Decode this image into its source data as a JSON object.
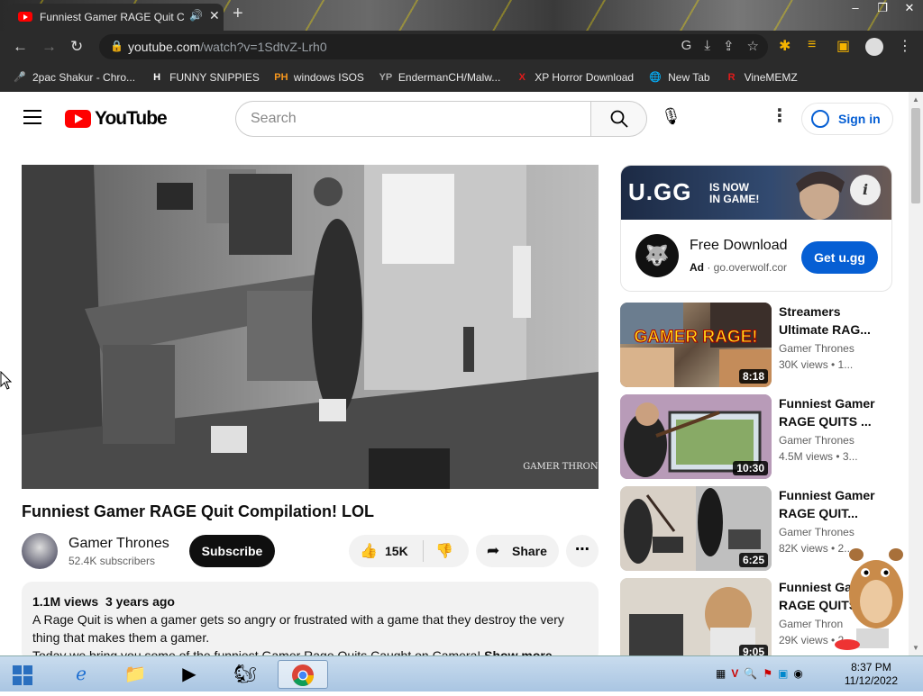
{
  "browser": {
    "tab_title": "Funniest Gamer RAGE Quit C",
    "new_tab": "+",
    "url_host": "youtube.com",
    "url_path": "/watch?v=1SdtvZ-Lrh0",
    "bookmarks": [
      {
        "label": "2pac Shakur - Chro...",
        "icon": "🎤",
        "color": "#e8e8e8"
      },
      {
        "label": "FUNNY SNIPPIES",
        "icon": "H",
        "color": "#ffffff"
      },
      {
        "label": "windows ISOS",
        "icon": "PH",
        "color": "#f7971d"
      },
      {
        "label": "EndermanCH/Malw...",
        "icon": "YP",
        "color": "#aaaaaa"
      },
      {
        "label": "XP Horror Download",
        "icon": "X",
        "color": "#e21b1b"
      },
      {
        "label": "New Tab",
        "icon": "🌐",
        "color": "#cccccc"
      },
      {
        "label": "VineMEMZ",
        "icon": "R",
        "color": "#e21b1b"
      }
    ]
  },
  "youtube": {
    "logo_text": "YouTube",
    "search_placeholder": "Search",
    "signin_label": "Sign in"
  },
  "video": {
    "title": "Funniest Gamer RAGE Quit Compilation! LOL",
    "channel": "Gamer Thrones",
    "subscribers": "52.4K subscribers",
    "subscribe_label": "Subscribe",
    "likes": "15K",
    "share_label": "Share",
    "watermark": "GAMER THRONES",
    "views": "1.1M views",
    "age": "3 years ago",
    "description_line1": "A Rage Quit is when a gamer gets so angry or frustrated with a game that they destroy the very",
    "description_line2": "thing that makes them a gamer.",
    "description_line3": "Today we bring you some of the funniest Gamer Rage Quits Caught on Camera!",
    "show_more": "Show more"
  },
  "ad": {
    "banner_brand": "U.GG",
    "banner_tagline_1": "IS NOW",
    "banner_tagline_2": "IN GAME!",
    "title": "Free Download",
    "badge": "Ad",
    "domain": "go.overwolf.cor",
    "cta": "Get u.gg"
  },
  "related": [
    {
      "title": "Streamers Ultimate RAG...",
      "channel": "Gamer Thrones",
      "meta": "30K views  • 1...",
      "duration": "8:18",
      "thumb_text": "GAMER RAGE!"
    },
    {
      "title": "Funniest Gamer RAGE QUITS ...",
      "channel": "Gamer Thrones",
      "meta": "4.5M views  • 3...",
      "duration": "10:30",
      "thumb_text": ""
    },
    {
      "title": "Funniest Gamer RAGE QUIT...",
      "channel": "Gamer Thrones",
      "meta": "82K views  • 2...",
      "duration": "6:25",
      "thumb_text": ""
    },
    {
      "title": "Funniest Gam RAGE QUITS",
      "channel": "Gamer Thron",
      "meta": "29K views  • 2",
      "duration": "9:05",
      "thumb_text": ""
    }
  ],
  "taskbar": {
    "time": "8:37 PM",
    "date": "11/12/2022"
  }
}
